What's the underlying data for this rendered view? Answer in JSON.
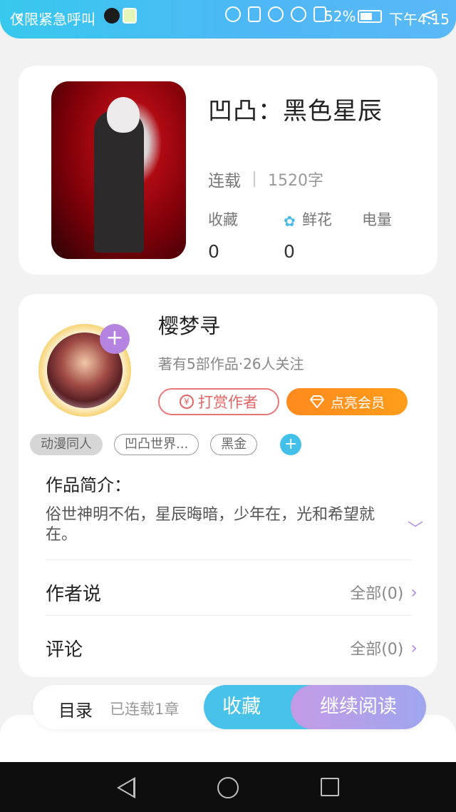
{
  "status_bar": {
    "carrier": "仅限紧急呼叫",
    "battery_pct": "52%",
    "time": "下午4:15"
  },
  "book": {
    "title": "凹凸：黑色星辰",
    "status": "连载",
    "word_count": "1520字",
    "stats": [
      {
        "label": "收藏",
        "value": "0"
      },
      {
        "label": "鲜花",
        "value": "0"
      },
      {
        "label": "电量",
        "value": ""
      }
    ]
  },
  "author": {
    "name": "樱梦寻",
    "meta": "著有5部作品·26人关注",
    "tip_label": "打赏作者",
    "vip_label": "点亮会员"
  },
  "tags": [
    "动漫同人",
    "凹凸世界...",
    "黑金"
  ],
  "intro": {
    "label": "作品简介：",
    "text": "俗世神明不佑，星辰晦暗，少年在，光和希望就在。"
  },
  "author_says": {
    "label": "作者说",
    "count": "全部(0)"
  },
  "comments": {
    "label": "评论",
    "count": "全部(0)"
  },
  "action_bar": {
    "toc": "目录",
    "chapters": "已连载1章",
    "collect": "收藏",
    "read": "继续阅读"
  },
  "colors": {
    "accent_blue": "#49c2ea",
    "accent_purple": "#b28be0",
    "vip_orange": "#ff8a1e",
    "tip_red": "#e06666"
  }
}
